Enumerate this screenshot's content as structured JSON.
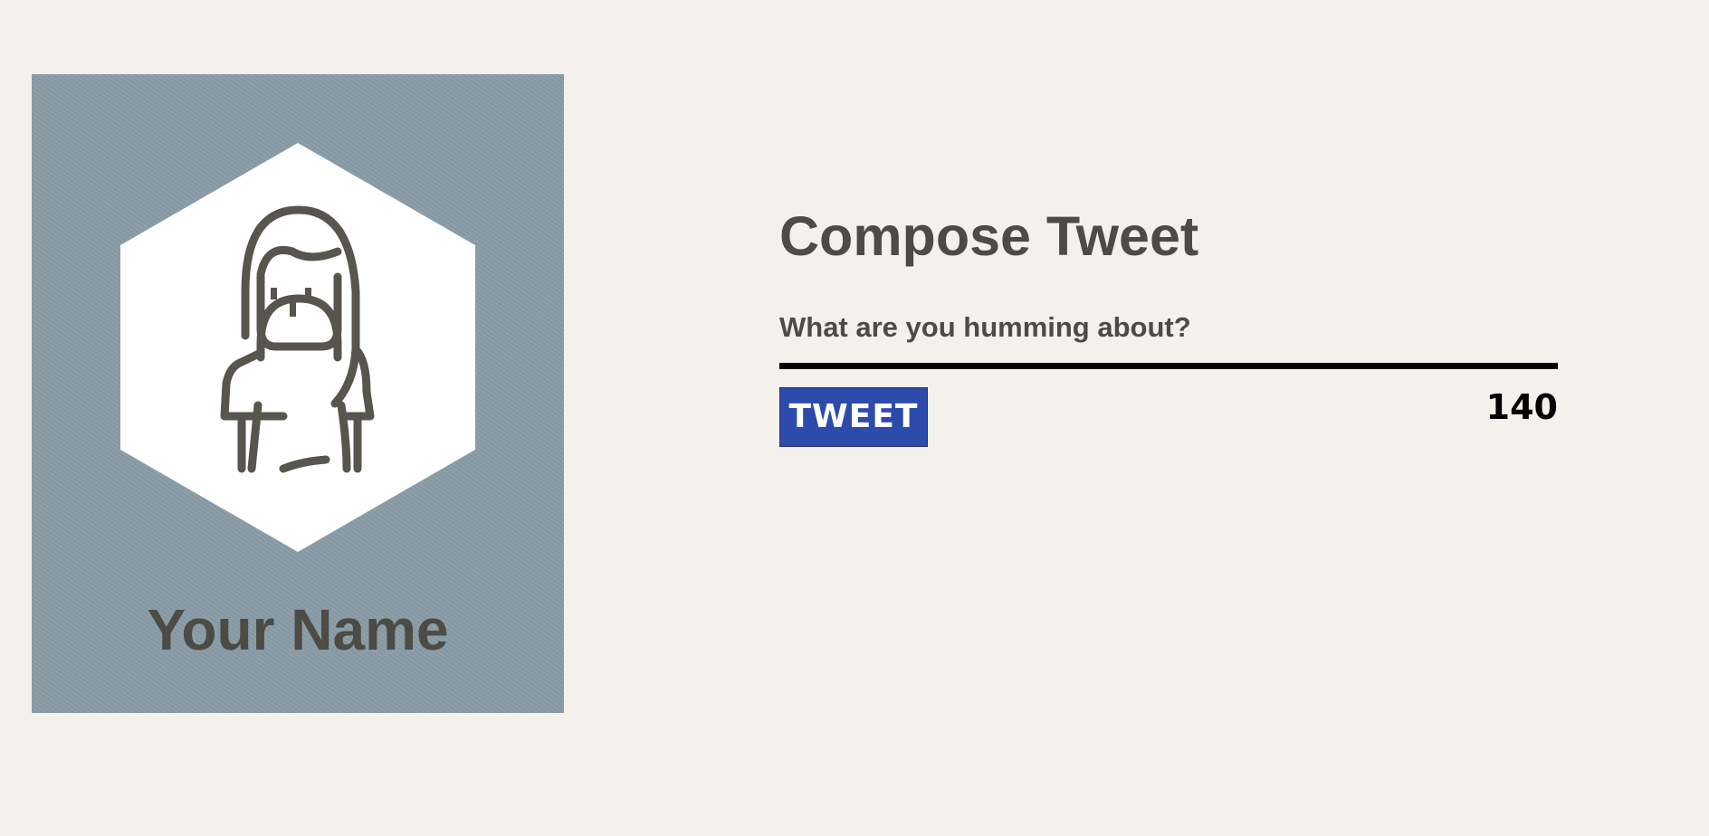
{
  "profile": {
    "name": "Your Name",
    "avatar_icon": "woman-avatar-icon",
    "card_color": "#8a9ea8"
  },
  "compose": {
    "title": "Compose Tweet",
    "placeholder": "What are you humming about?",
    "value": "",
    "tweet_label": "TWEET",
    "char_count": "140",
    "button_color": "#2d4bab"
  }
}
